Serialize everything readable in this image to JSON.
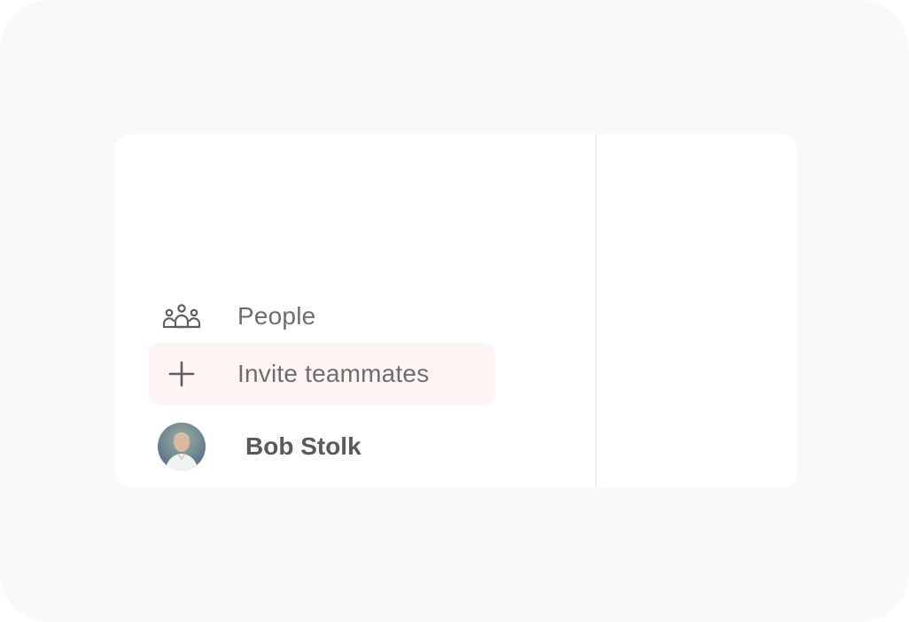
{
  "sidebar": {
    "items": [
      {
        "label": "People",
        "icon": "people-icon"
      },
      {
        "label": "Invite teammates",
        "icon": "plus-icon",
        "highlighted": true
      }
    ],
    "user": {
      "name": "Bob Stolk",
      "icon": "avatar"
    }
  },
  "colors": {
    "background": "#f9f9f9",
    "panel": "#ffffff",
    "highlight": "#fff4f4",
    "text": "#6e6e6e",
    "divider": "#e6e6e6"
  }
}
